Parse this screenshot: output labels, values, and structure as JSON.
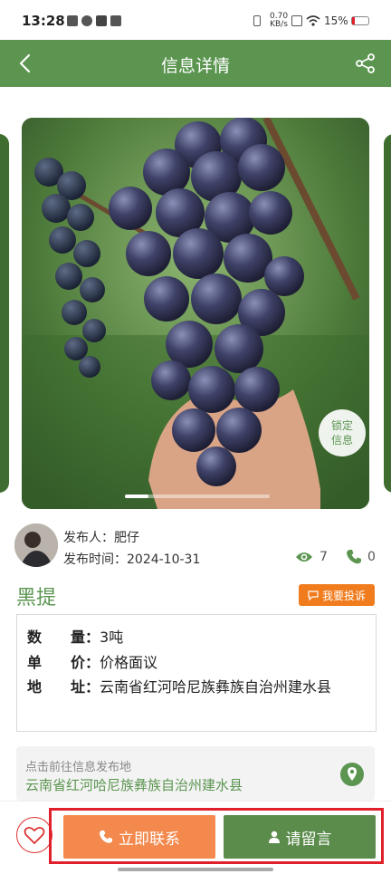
{
  "status_bar": {
    "time": "13:28",
    "net_speed_value": "0.70",
    "net_speed_unit": "KB/s",
    "battery": "15%"
  },
  "header": {
    "title": "信息详情",
    "back_icon": "back-arrow-icon",
    "share_icon": "share-icon"
  },
  "gallery": {
    "lock_line1": "锁定",
    "lock_line2": "信息"
  },
  "publisher": {
    "name_label": "发布人：",
    "name": "肥仔",
    "time_label": "发布时间：",
    "time": "2024-10-31",
    "views": "7",
    "calls": "0"
  },
  "product": {
    "name": "黑提",
    "complaint_label": "我要投诉",
    "details": [
      {
        "label": "数　　量：",
        "value": "3吨"
      },
      {
        "label": "单　　价：",
        "value": "价格面议"
      },
      {
        "label": "地　　址：",
        "value": "云南省红河哈尼族彝族自治州建水县"
      }
    ]
  },
  "navigation": {
    "hint": "点击前往信息发布地",
    "address": "云南省红河哈尼族彝族自治州建水县"
  },
  "actions": {
    "contact_label": "立即联系",
    "message_label": "请留言"
  },
  "colors": {
    "brand_green": "#5b9550",
    "orange": "#f3894c",
    "complaint_orange": "#f07c1e",
    "highlight_red": "#e0202a"
  }
}
